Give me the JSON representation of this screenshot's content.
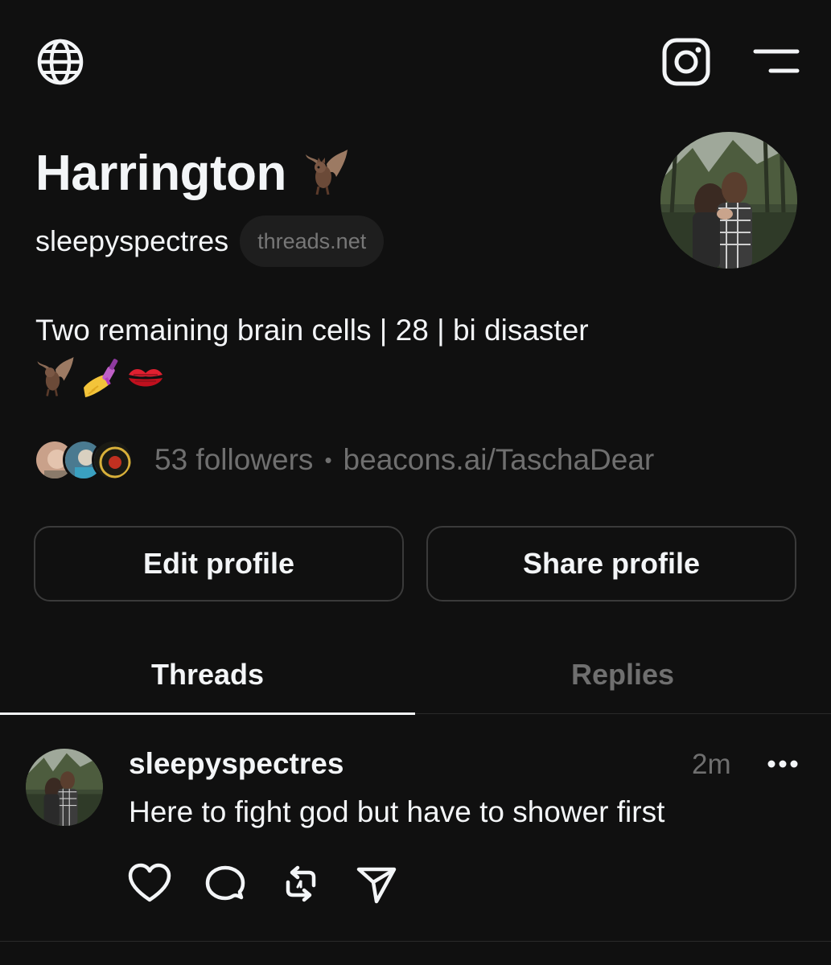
{
  "header": {
    "icons": [
      "globe-icon",
      "instagram-icon",
      "menu-icon"
    ]
  },
  "profile": {
    "display_name": "Harrington",
    "name_emoji": "bat",
    "username": "sleepyspectres",
    "domain_badge": "threads.net",
    "bio": "Two remaining brain cells | 28 | bi disaster",
    "bio_emojis": [
      "bat",
      "nail-polish",
      "kiss-mark"
    ],
    "followers": "53 followers",
    "separator": "•",
    "link": "beacons.ai/TaschaDear"
  },
  "buttons": {
    "edit": "Edit profile",
    "share": "Share profile"
  },
  "tabs": [
    {
      "label": "Threads",
      "active": true
    },
    {
      "label": "Replies",
      "active": false
    }
  ],
  "post": {
    "username": "sleepyspectres",
    "time": "2m",
    "text": "Here to fight god but have to shower first",
    "actions": [
      "heart-icon",
      "comment-icon",
      "repost-icon",
      "share-icon"
    ]
  },
  "colors": {
    "background": "#101010",
    "text": "#f3f5f7",
    "muted": "#6f6f6f",
    "border": "#3a3a3a"
  }
}
